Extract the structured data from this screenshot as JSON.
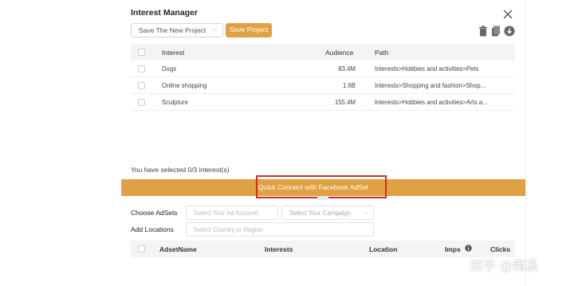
{
  "dialog": {
    "title": "Interest Manager",
    "project_select": "Save The New Project",
    "save_button": "Save Project"
  },
  "interests_table": {
    "headers": [
      "Interest",
      "Audience",
      "Path"
    ],
    "rows": [
      {
        "interest": "Dogs",
        "audience": "83.4M",
        "path": "Interests>Hobbies and activities>Pets"
      },
      {
        "interest": "Online shopping",
        "audience": "1.6B",
        "path": "Interests>Shopping and fashion>Shop..."
      },
      {
        "interest": "Sculpture",
        "audience": "155.4M",
        "path": "Interests>Hobbies and activities>Arts a..."
      }
    ]
  },
  "selection_status": "You have selected 0/3 interest(s)",
  "quick_connect": "Quick Connect with Facebook AdSet",
  "adsets": {
    "choose_label": "Choose AdSets",
    "account_placeholder": "Select Your Ad Account",
    "campaign_placeholder": "Select Your Campaign",
    "locations_label": "Add Locations",
    "locations_placeholder": "Select Country or Region"
  },
  "adset_table": {
    "headers": [
      "AdsetName",
      "Interests",
      "Location",
      "Imps",
      "Clicks"
    ]
  },
  "watermark": "知乎 @南溪",
  "colors": {
    "accent": "#e0a144",
    "highlight_box": "#d62b2b"
  },
  "icons": [
    "close-icon",
    "trash-icon",
    "copy-icon",
    "download-icon",
    "info-icon",
    "chevron-down-icon"
  ]
}
